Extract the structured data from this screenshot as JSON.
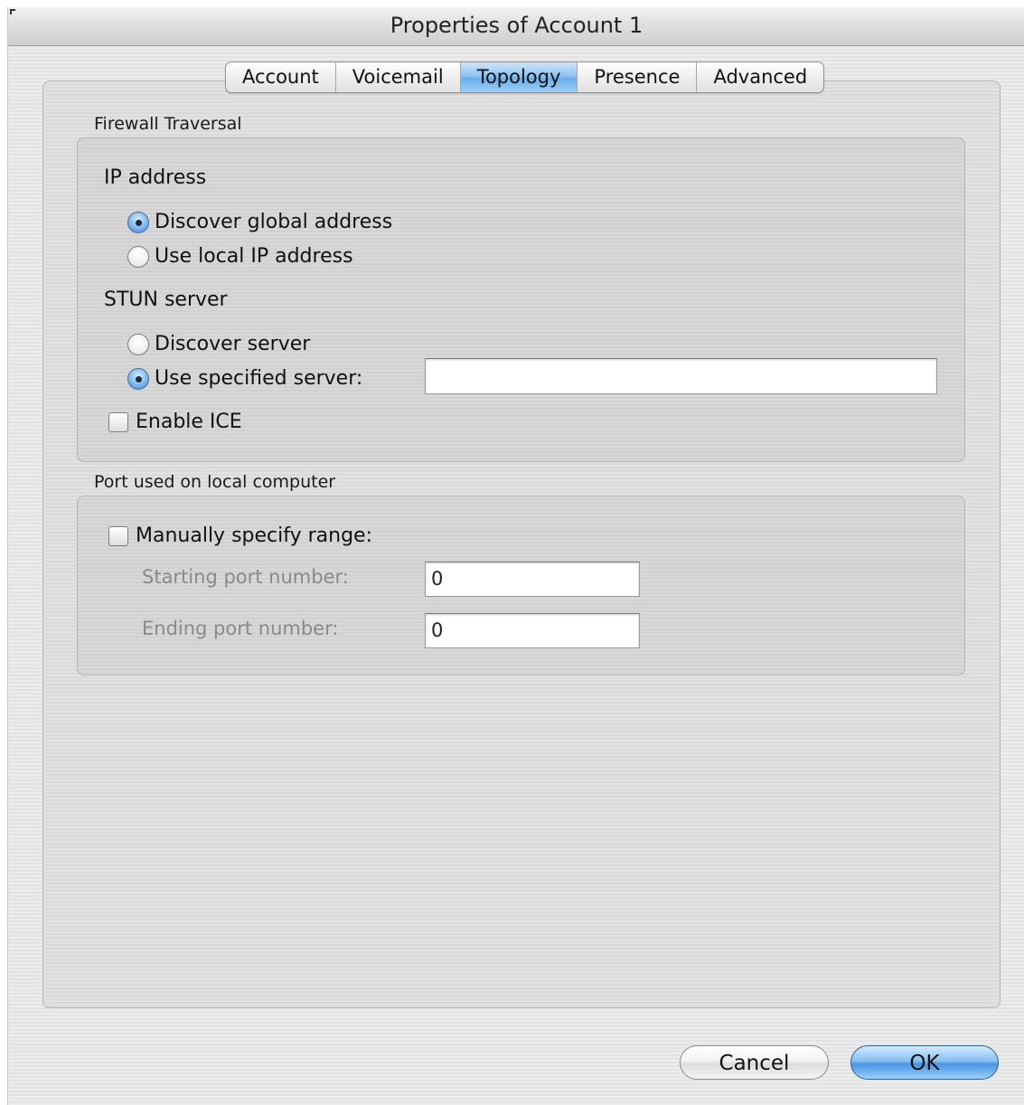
{
  "window": {
    "title": "Properties of Account 1"
  },
  "tabs": [
    {
      "label": "Account",
      "active": false
    },
    {
      "label": "Voicemail",
      "active": false
    },
    {
      "label": "Topology",
      "active": true
    },
    {
      "label": "Presence",
      "active": false
    },
    {
      "label": "Advanced",
      "active": false
    }
  ],
  "firewall": {
    "section_label": "Firewall Traversal",
    "ip_address": {
      "label": "IP address",
      "options": [
        {
          "label": "Discover global address",
          "selected": true
        },
        {
          "label": "Use local IP address",
          "selected": false
        }
      ]
    },
    "stun_server": {
      "label": "STUN server",
      "options": [
        {
          "label": "Discover server",
          "selected": false
        },
        {
          "label": "Use specified server:",
          "selected": true
        }
      ],
      "server_value": ""
    },
    "enable_ice": {
      "label": "Enable ICE",
      "checked": false
    }
  },
  "port": {
    "section_label": "Port used on local computer",
    "manual_range": {
      "label": "Manually specify range:",
      "checked": false
    },
    "starting": {
      "label": "Starting port number:",
      "value": "0"
    },
    "ending": {
      "label": "Ending port number:",
      "value": "0"
    }
  },
  "buttons": {
    "cancel": "Cancel",
    "ok": "OK"
  },
  "colors": {
    "accent": "#6aaeea",
    "ok_button": "#4a95e4"
  }
}
